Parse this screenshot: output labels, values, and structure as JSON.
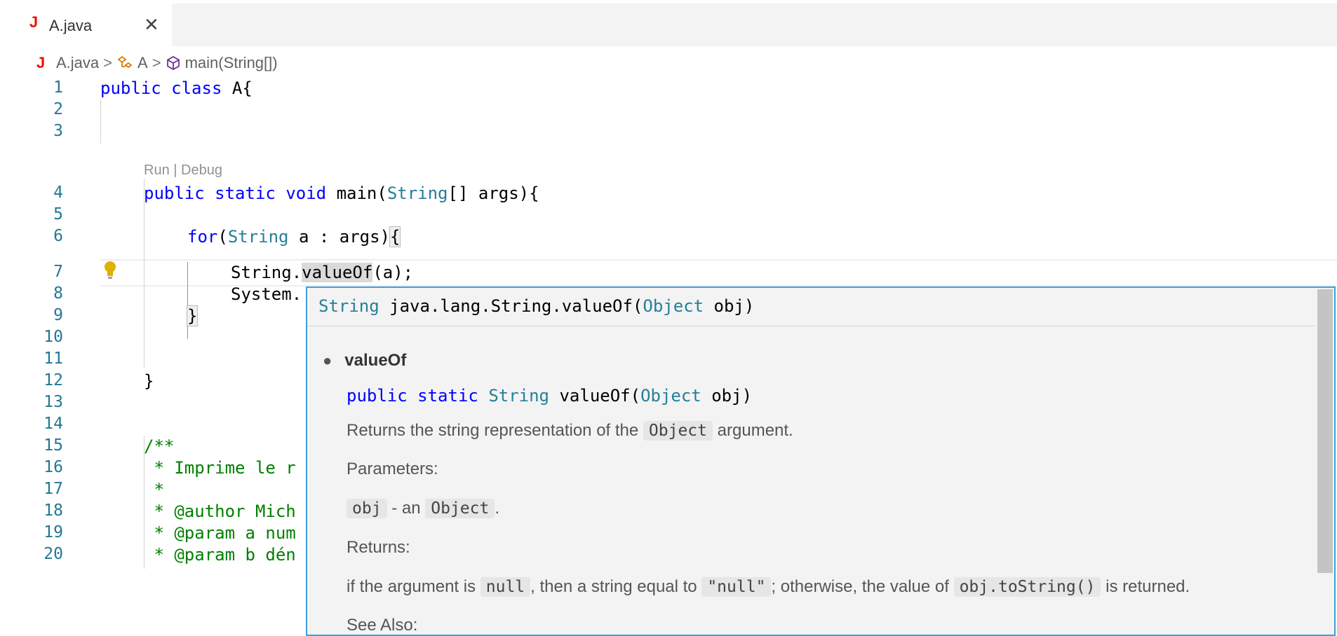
{
  "tab": {
    "label": "A.java",
    "close": "✕",
    "icon": "java-file-icon"
  },
  "breadcrumb": {
    "file": "A.java",
    "class": "A",
    "method": "main(String[])",
    "sep": ">"
  },
  "editor": {
    "line_numbers": [
      "1",
      "2",
      "3",
      "4",
      "5",
      "6",
      "7",
      "8",
      "9",
      "10",
      "11",
      "12",
      "13",
      "14",
      "15",
      "16",
      "17",
      "18",
      "19",
      "20"
    ],
    "codelens": {
      "run": "Run",
      "sep": " | ",
      "debug": "Debug"
    },
    "l1": {
      "a": "public",
      "b": " ",
      "c": "class",
      "d": " A{"
    },
    "l4": {
      "a": "public",
      "b": "static",
      "c": "void",
      "d": "main",
      "e": "(",
      "f": "String",
      "g": "[] args){"
    },
    "l6": {
      "a": "for",
      "b": "(",
      "c": "String",
      "d": " a : args)",
      "e": "{"
    },
    "l7": {
      "a": "String.",
      "b": "valueOf",
      "c": "(a);"
    },
    "l8": {
      "a": "System."
    },
    "l9": {
      "a": "}"
    },
    "l12": {
      "a": "}"
    },
    "l15": {
      "a": "/**"
    },
    "l16": {
      "a": " * Imprime le r"
    },
    "l17": {
      "a": " *"
    },
    "l18": {
      "a": " * @author Mich"
    },
    "l19": {
      "a": " * @param a num"
    },
    "l20": {
      "a": " * @param b dén"
    }
  },
  "hover": {
    "sig_type": "String",
    "sig_name": " java.lang.String.valueOf(",
    "sig_param_type": "Object",
    "sig_param": " obj)",
    "bullet": "valueOf",
    "decl": {
      "kw1": "public",
      "kw2": "static",
      "type": "String",
      "name": " valueOf(",
      "ptype": "Object",
      "pname": " obj)"
    },
    "desc_pre": "Returns the string representation of the ",
    "desc_code": "Object",
    "desc_post": " argument.",
    "params_label": "Parameters:",
    "param_name": "obj",
    "param_mid": " - an ",
    "param_code": "Object",
    "param_end": ".",
    "returns_label": "Returns:",
    "ret_pre": "if the argument is ",
    "ret_code1": "null",
    "ret_mid": ", then a string equal to ",
    "ret_code2": "\"null\"",
    "ret_mid2": "; otherwise, the value of ",
    "ret_code3": "obj.toString()",
    "ret_post": " is returned.",
    "see_also": "See Also:"
  }
}
